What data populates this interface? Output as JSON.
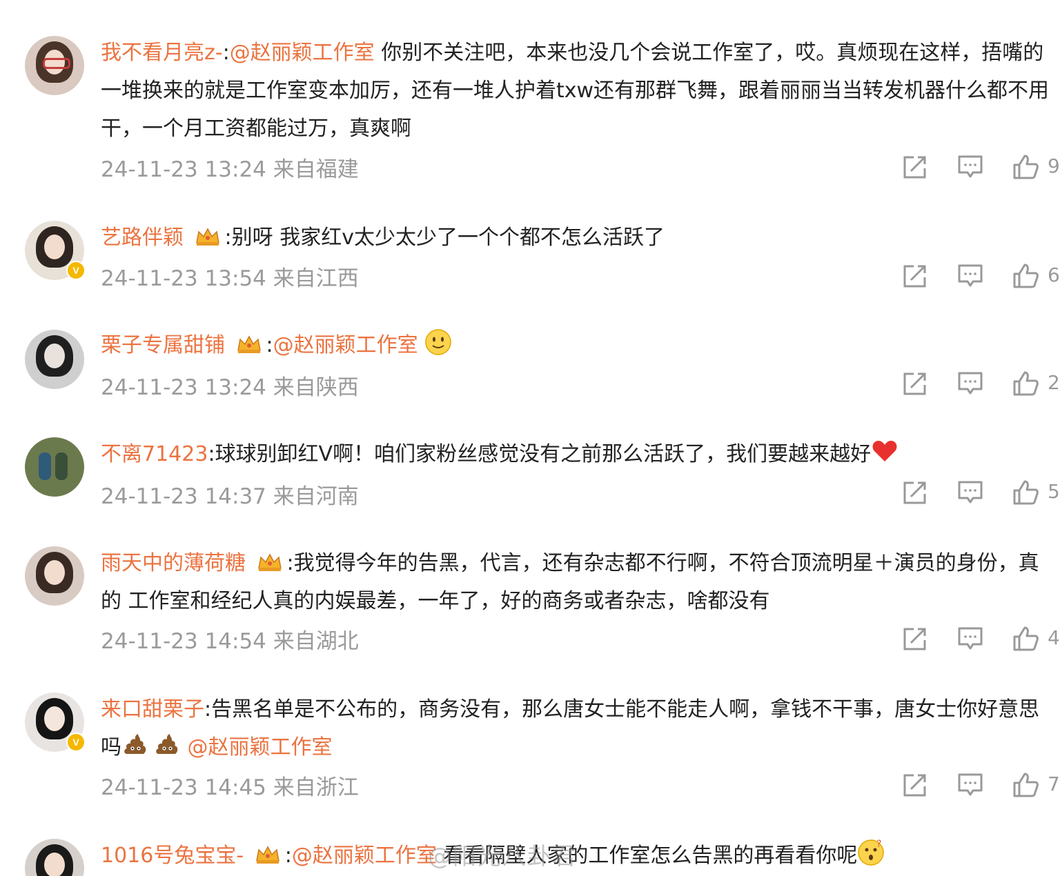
{
  "comments": [
    {
      "username": "我不看月亮z-",
      "sep": ":",
      "mention": "@赵丽颖工作室",
      "text": " 你别不关注吧，本来也没几个会说工作室了，哎。真烦现在这样，捂嘴的一堆换来的就是工作室变本加厉，还有一堆人护着txw还有那群飞舞，跟着丽丽当当转发机器什么都不用干，一个月工资都能过万，真爽啊",
      "time": "24-11-23 13:24",
      "location": "来自福建",
      "likes": "9"
    },
    {
      "username": "艺路伴颖",
      "sep": ":",
      "text": "别呀 我家红v太少太少了一个个都不怎么活跃了",
      "time": "24-11-23 13:54",
      "location": "来自江西",
      "likes": "6"
    },
    {
      "username": "栗子专属甜铺",
      "sep": ":",
      "mention": "@赵丽颖工作室",
      "time": "24-11-23 13:24",
      "location": "来自陕西",
      "likes": "2"
    },
    {
      "username": "不离71423",
      "sep": ":",
      "text": "球球别卸红V啊！咱们家粉丝感觉没有之前那么活跃了，我们要越来越好",
      "time": "24-11-23 14:37",
      "location": "来自河南",
      "likes": "5"
    },
    {
      "username": "雨天中的薄荷糖",
      "sep": ":",
      "text": "我觉得今年的告黑，代言，还有杂志都不行啊，不符合顶流明星＋演员的身份，真的 工作室和经纪人真的内娱最差，一年了，好的商务或者杂志，啥都没有",
      "time": "24-11-23 14:54",
      "location": "来自湖北",
      "likes": "4"
    },
    {
      "username": "来口甜栗子",
      "sep": ":",
      "text": "告黑名单是不公布的，商务没有，那么唐女士能不能走人啊，拿钱不干事，唐女士你好意思吗",
      "mention": "@赵丽颖工作室",
      "time": "24-11-23 14:45",
      "location": "来自浙江",
      "likes": "7"
    },
    {
      "username": "1016号兔宝宝-",
      "sep": ":",
      "mention": "@赵丽颖工作室",
      "text": " 看看隔壁人家的工作室怎么告黑的再看看你呢"
    }
  ],
  "watermark": "@阳光八卦君",
  "icons": {
    "share": "share-icon",
    "comment": "comment-icon",
    "like": "like-icon",
    "crown": "crown-icon",
    "verified": "verified-badge-icon"
  },
  "colors": {
    "username": "#eb7340",
    "meta": "#9a9a9a",
    "text": "#222222",
    "badge": "#f5b800"
  }
}
